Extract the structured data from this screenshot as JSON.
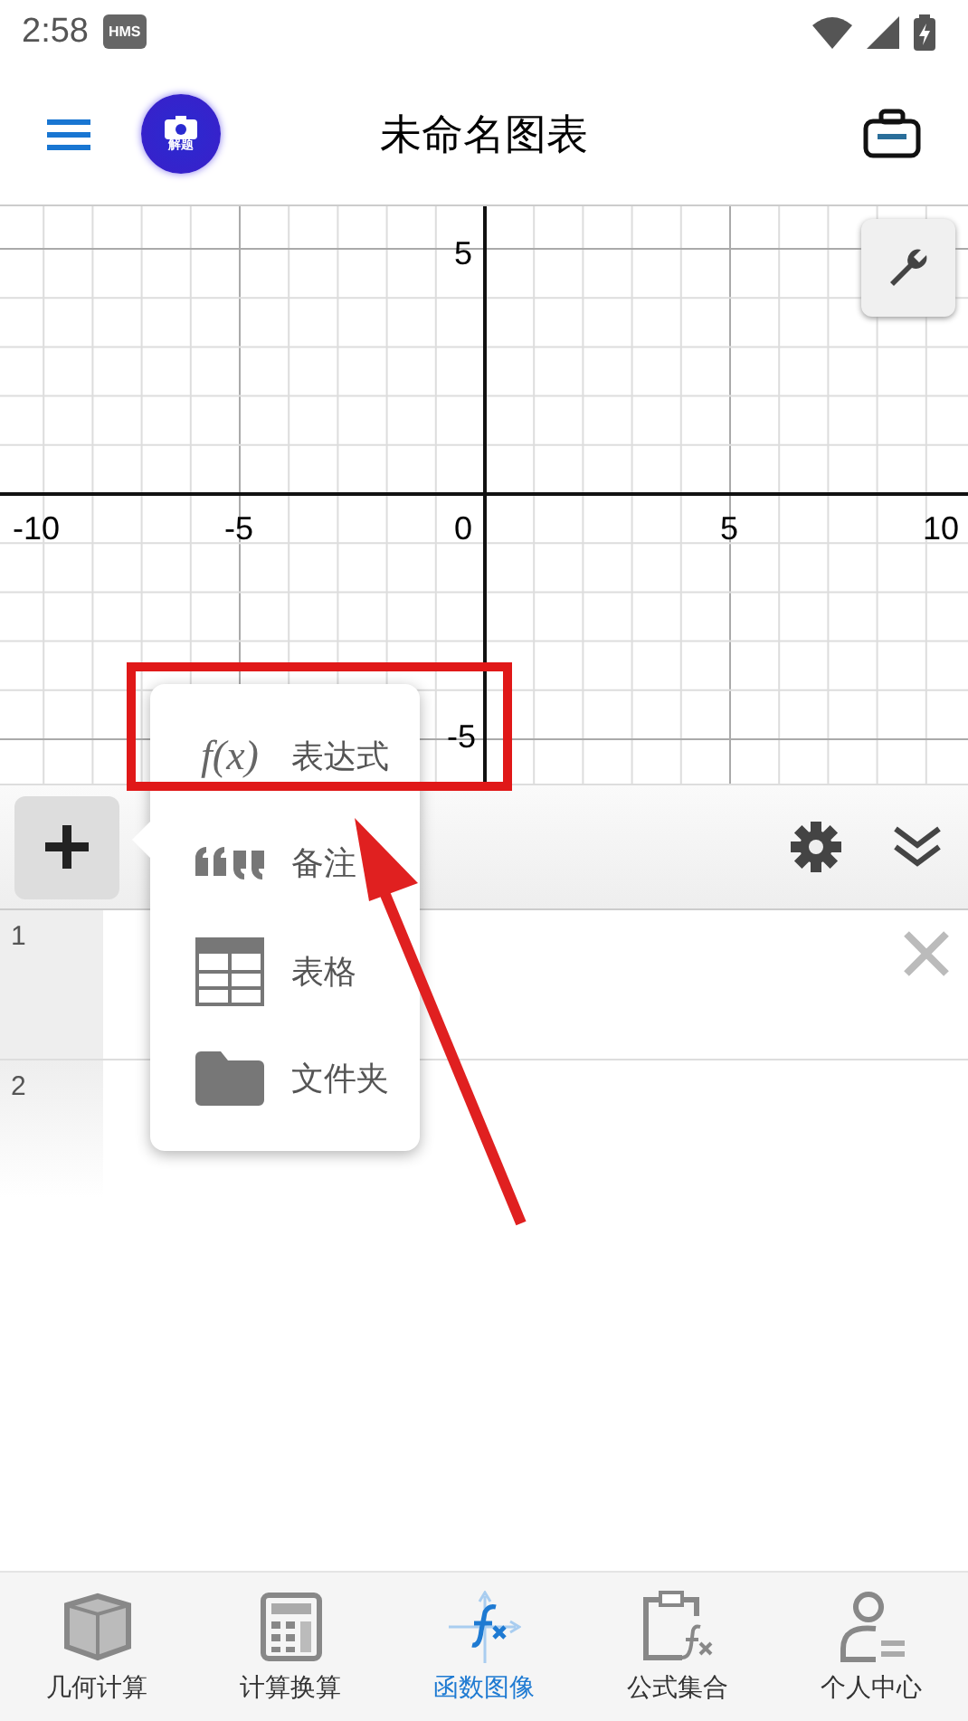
{
  "status_bar": {
    "time": "2:58",
    "badge": "HMS"
  },
  "app_bar": {
    "title": "未命名图表",
    "camera_badge": "解题"
  },
  "graph": {
    "x_labels": [
      "-10",
      "-5",
      "0",
      "5",
      "10"
    ],
    "y_labels": [
      "5",
      "-5"
    ]
  },
  "add_menu": {
    "items": [
      {
        "kind": "expression",
        "icon_text": "f(x)",
        "label": "表达式"
      },
      {
        "kind": "note",
        "label": "备注"
      },
      {
        "kind": "table",
        "label": "表格"
      },
      {
        "kind": "folder",
        "label": "文件夹"
      }
    ]
  },
  "expression_list": {
    "rows": [
      {
        "number": "1",
        "deletable": true
      },
      {
        "number": "2",
        "deletable": false
      }
    ]
  },
  "annotations": {
    "highlight_box": true,
    "arrow": true
  },
  "bottom_nav": [
    {
      "kind": "geometry",
      "label": "几何计算",
      "selected": false
    },
    {
      "kind": "calculator",
      "label": "计算换算",
      "selected": false
    },
    {
      "kind": "graph",
      "label": "函数图像",
      "selected": true
    },
    {
      "kind": "formulas",
      "label": "公式集合",
      "selected": false
    },
    {
      "kind": "profile",
      "label": "个人中心",
      "selected": false
    }
  ]
}
